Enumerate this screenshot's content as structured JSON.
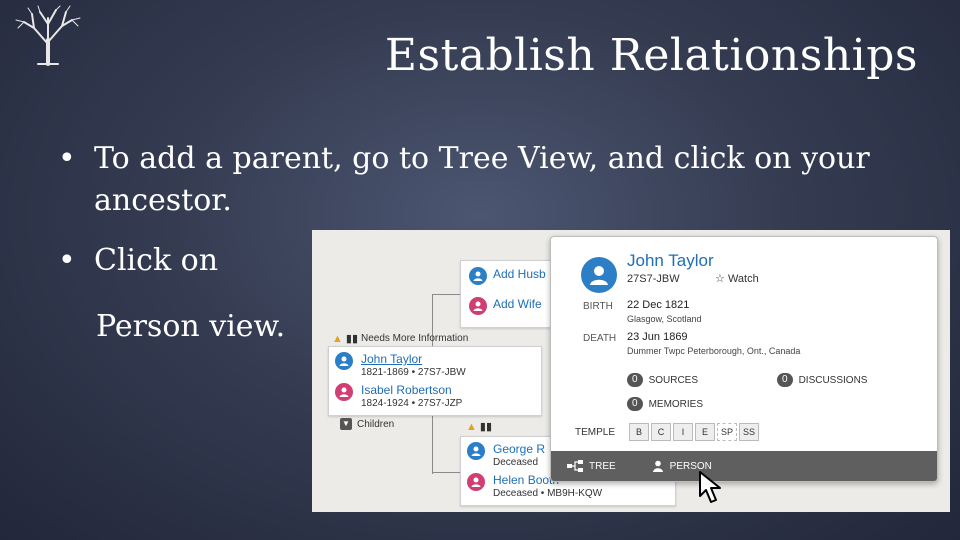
{
  "slide": {
    "title": "Establish Relationships",
    "bullets": [
      "To add a parent, go to  Tree View, and click on your ancestor.",
      "Click on",
      "Person view."
    ]
  },
  "screenshot": {
    "add_husband": "Add Husb",
    "add_wife": "Add Wife",
    "needs_more_info": "Needs More Information",
    "children": "Children",
    "main_couple": {
      "husband": {
        "name": "John Taylor",
        "years": "1821-1869",
        "id": "27S7-JBW"
      },
      "wife": {
        "name": "Isabel Robertson",
        "years": "1824-1924",
        "id": "27S7-JZP"
      }
    },
    "lower_couple": {
      "husband": {
        "name": "George R",
        "status": "Deceased"
      },
      "wife": {
        "name": "Helen Booth",
        "status": "Deceased",
        "id": "MB9H-KQW"
      }
    },
    "popup": {
      "name": "John Taylor",
      "id": "27S7-JBW",
      "watch": "Watch",
      "birth_label": "BIRTH",
      "birth_date": "22 Dec 1821",
      "birth_place": "Glasgow, Scotland",
      "death_label": "DEATH",
      "death_date": "23 Jun 1869",
      "death_place": "Dummer Twpc Peterborough, Ont., Canada",
      "sources_count": "0",
      "sources_label": "SOURCES",
      "discussions_count": "0",
      "discussions_label": "DISCUSSIONS",
      "memories_count": "0",
      "memories_label": "MEMORIES",
      "temple_label": "TEMPLE",
      "temple_ordinances": [
        "B",
        "C",
        "I",
        "E",
        "SP",
        "SS"
      ],
      "tree_button": "TREE",
      "person_button": "PERSON"
    }
  },
  "colors": {
    "male": "#2c7ec6",
    "female": "#cf3f74",
    "link": "#1e6eb8"
  }
}
